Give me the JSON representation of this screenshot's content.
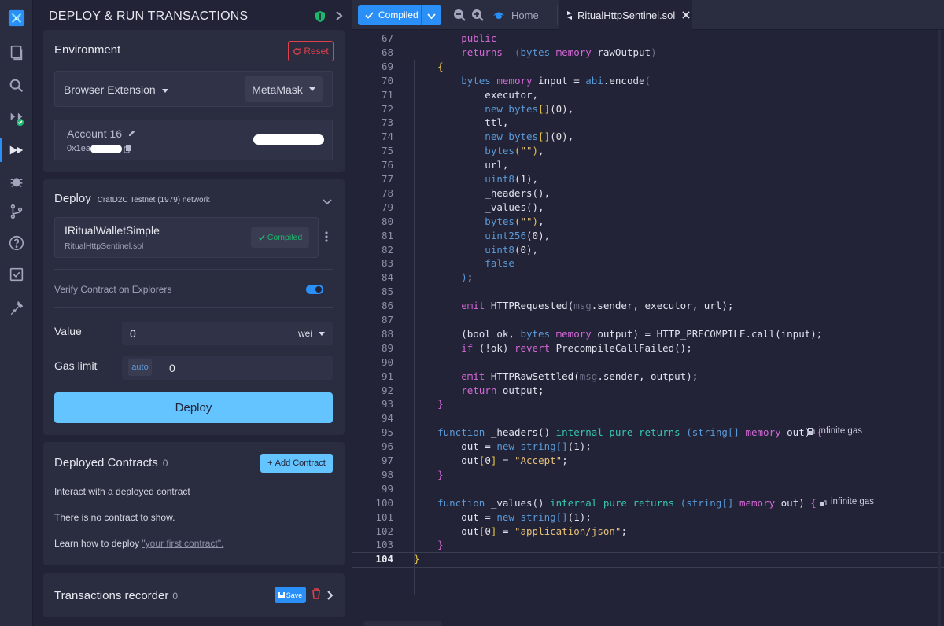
{
  "panel": {
    "title": "DEPLOY & RUN TRANSACTIONS",
    "environment": {
      "title": "Environment",
      "reset": "Reset",
      "provider": "Browser Extension",
      "wallet": "MetaMask",
      "account_label": "Account 16",
      "account_address": "0x1ea"
    },
    "deploy": {
      "title": "Deploy",
      "network": "CratD2C Testnet (1979) network",
      "contract_name": "IRitualWalletSimple",
      "contract_file": "RitualHttpSentinel.sol",
      "compiled_badge": "Compiled",
      "verify_label": "Verify Contract on Explorers",
      "value_label": "Value",
      "value": "0",
      "value_unit": "wei",
      "gas_label": "Gas limit",
      "gas_mode": "auto",
      "gas_value": "0",
      "deploy_button": "Deploy"
    },
    "deployed": {
      "title": "Deployed Contracts",
      "count": "0",
      "add_button": "Add Contract",
      "interact_text": "Interact with a deployed contract",
      "empty_text": "There is no contract to show.",
      "learn_text": "Learn how to deploy",
      "learn_link": "\"your first contract\"."
    },
    "recorder": {
      "title": "Transactions recorder",
      "count": "0",
      "save": "Save"
    }
  },
  "tabs": {
    "compiled": "Compiled",
    "home": "Home",
    "file": "RitualHttpSentinel.sol"
  },
  "editor": {
    "line_numbers": [
      "67",
      "68",
      "69",
      "70",
      "71",
      "72",
      "73",
      "74",
      "75",
      "76",
      "77",
      "78",
      "79",
      "80",
      "81",
      "82",
      "83",
      "84",
      "85",
      "86",
      "87",
      "88",
      "89",
      "90",
      "91",
      "92",
      "93",
      "94",
      "95",
      "96",
      "97",
      "98",
      "99",
      "100",
      "101",
      "102",
      "103",
      "104"
    ],
    "gas_note": "infinite gas",
    "code": [
      [
        [
          "k1",
          "        public"
        ]
      ],
      [
        [
          "k1",
          "        returns"
        ],
        [
          "",
          "  "
        ],
        [
          "dim",
          "("
        ],
        [
          "k2",
          "bytes"
        ],
        [
          "",
          ""
        ],
        [
          "k1",
          " memory"
        ],
        [
          "",
          " rawOutput"
        ],
        [
          "dim",
          ")"
        ]
      ],
      [
        [
          "br",
          "    {"
        ]
      ],
      [
        [
          "k2",
          "        bytes"
        ],
        [
          "k1",
          " memory"
        ],
        [
          "",
          " input = "
        ],
        [
          "k2",
          "abi"
        ],
        [
          "",
          ".encode"
        ],
        [
          "dim",
          "("
        ]
      ],
      [
        [
          "",
          "            executor,"
        ]
      ],
      [
        [
          "k2",
          "            new"
        ],
        [
          "k2",
          " bytes"
        ],
        [
          "br",
          "[]"
        ],
        [
          "",
          "("
        ],
        [
          "num",
          "0"
        ],
        [
          "",
          "),"
        ]
      ],
      [
        [
          "",
          "            ttl,"
        ]
      ],
      [
        [
          "k2",
          "            new"
        ],
        [
          "k2",
          " bytes"
        ],
        [
          "br",
          "[]"
        ],
        [
          "",
          "("
        ],
        [
          "num",
          "0"
        ],
        [
          "",
          "),"
        ]
      ],
      [
        [
          "k2",
          "            bytes"
        ],
        [
          "br",
          "("
        ],
        [
          "str",
          "\"\""
        ],
        [
          "br",
          ")"
        ],
        [
          ",",
          ","
        ]
      ],
      [
        [
          "",
          "            url,"
        ]
      ],
      [
        [
          "k2",
          "            uint8"
        ],
        [
          "",
          "("
        ],
        [
          "num",
          "1"
        ],
        [
          "",
          "),"
        ]
      ],
      [
        [
          "",
          "            _headers(),"
        ]
      ],
      [
        [
          "",
          "            _values(),"
        ]
      ],
      [
        [
          "k2",
          "            bytes"
        ],
        [
          "br",
          "("
        ],
        [
          "str",
          "\"\""
        ],
        [
          "br",
          ")"
        ],
        [
          "",
          ","
        ]
      ],
      [
        [
          "k2",
          "            uint256"
        ],
        [
          "",
          "("
        ],
        [
          "num",
          "0"
        ],
        [
          "",
          "),"
        ]
      ],
      [
        [
          "k2",
          "            uint8"
        ],
        [
          "",
          "("
        ],
        [
          "num",
          "0"
        ],
        [
          "",
          "),"
        ]
      ],
      [
        [
          "k2",
          "            false"
        ]
      ],
      [
        [
          "",
          "        "
        ],
        [
          "k2",
          ")"
        ],
        [
          "",
          ";"
        ]
      ],
      [
        [
          "",
          ""
        ]
      ],
      [
        [
          "k1",
          "        emit"
        ],
        [
          "",
          " HTTPRequested("
        ],
        [
          "dim",
          "msg"
        ],
        [
          "",
          ".sender, executor, url);"
        ]
      ],
      [
        [
          "",
          ""
        ]
      ],
      [
        [
          "",
          "        (bool ok, "
        ],
        [
          "k2",
          "bytes"
        ],
        [
          "k1",
          " memory"
        ],
        [
          "",
          " output) = HTTP_PRECOMPILE.call(input);"
        ]
      ],
      [
        [
          "k1",
          "        if"
        ],
        [
          "",
          " (!ok) "
        ],
        [
          "k1",
          "revert"
        ],
        [
          "",
          " PrecompileCallFailed();"
        ]
      ],
      [
        [
          "",
          ""
        ]
      ],
      [
        [
          "k1",
          "        emit"
        ],
        [
          "",
          " HTTPRawSettled("
        ],
        [
          "dim",
          "msg"
        ],
        [
          "",
          ".sender, output);"
        ]
      ],
      [
        [
          "k1",
          "        return"
        ],
        [
          "",
          " output;"
        ]
      ],
      [
        [
          "k1",
          "    }"
        ]
      ],
      [
        [
          "",
          ""
        ]
      ],
      [
        [
          "k2",
          "    function"
        ],
        [
          "",
          " _headers() "
        ],
        [
          "k3",
          "internal pure returns"
        ],
        [
          "k2",
          " (string[]"
        ],
        [
          "k1",
          " memory"
        ],
        [
          "",
          " out) "
        ],
        [
          "k1",
          "{"
        ]
      ],
      [
        [
          "",
          "        out = "
        ],
        [
          "k2",
          "new string[]"
        ],
        [
          "",
          "(1);"
        ]
      ],
      [
        [
          "",
          "        out"
        ],
        [
          "br",
          "["
        ],
        [
          "num",
          "0"
        ],
        [
          "br",
          "]"
        ],
        [
          "",
          " = "
        ],
        [
          "str",
          "\"Accept\""
        ],
        [
          "",
          ";"
        ]
      ],
      [
        [
          "k1",
          "    }"
        ]
      ],
      [
        [
          "",
          ""
        ]
      ],
      [
        [
          "k2",
          "    function"
        ],
        [
          "",
          " _values() "
        ],
        [
          "k3",
          "internal pure returns"
        ],
        [
          "k2",
          " (string[]"
        ],
        [
          "k1",
          " memory"
        ],
        [
          "",
          " out) "
        ],
        [
          "k1",
          "{"
        ]
      ],
      [
        [
          "",
          "        out = "
        ],
        [
          "k2",
          "new string[]"
        ],
        [
          "",
          "(1);"
        ]
      ],
      [
        [
          "",
          "        out"
        ],
        [
          "br",
          "["
        ],
        [
          "num",
          "0"
        ],
        [
          "br",
          "]"
        ],
        [
          "",
          " = "
        ],
        [
          "str",
          "\"application/json\""
        ],
        [
          "",
          ";"
        ]
      ],
      [
        [
          "k1",
          "    }"
        ]
      ],
      [
        [
          "br",
          "}"
        ]
      ]
    ]
  }
}
